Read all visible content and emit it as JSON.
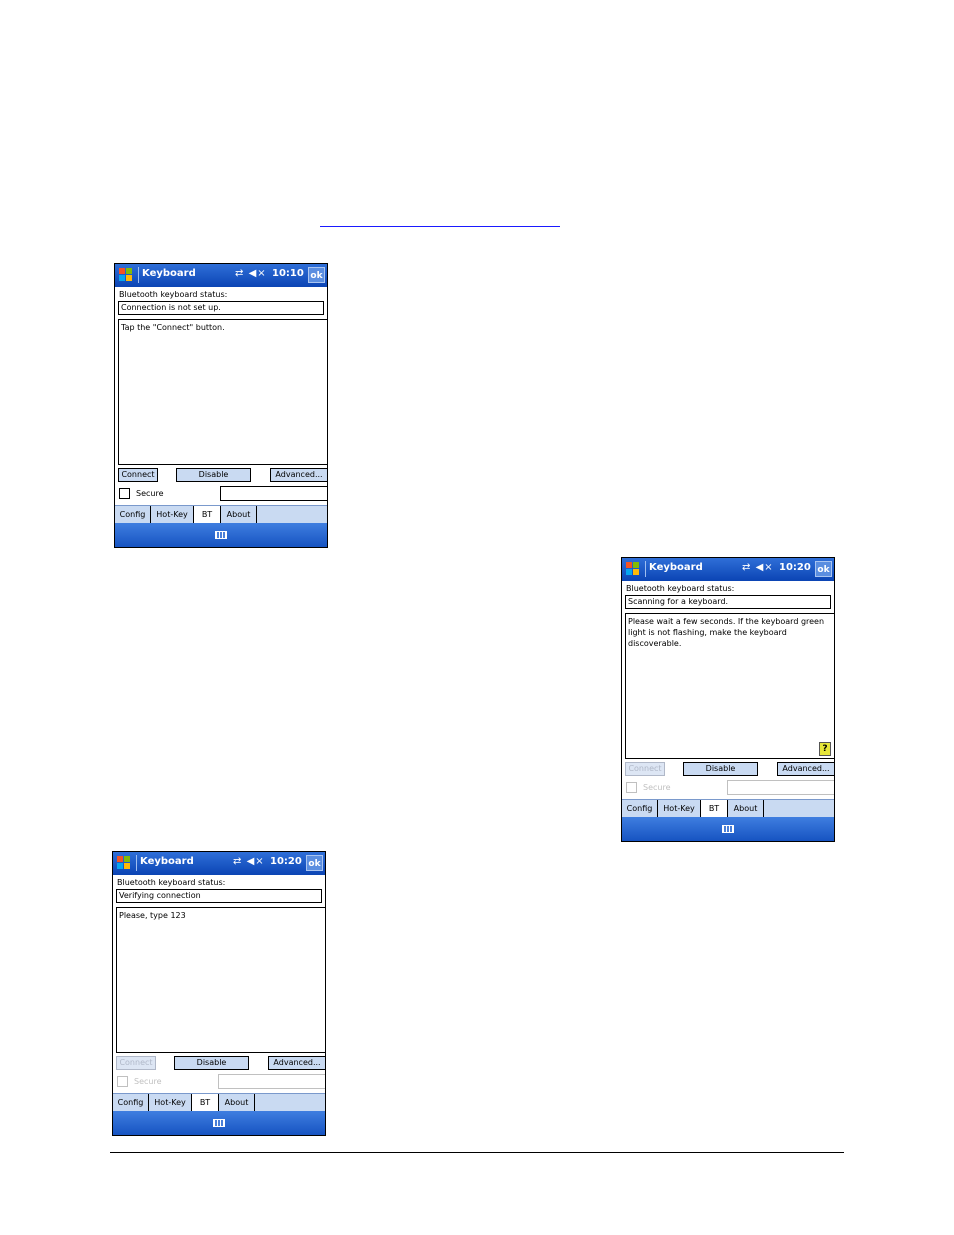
{
  "screens": [
    {
      "app_title": "Keyboard",
      "time": "10:10",
      "ok_label": "ok",
      "status_label": "Bluetooth keyboard status:",
      "status_value": "Connection is not set up.",
      "message": "Tap the \"Connect\" button.",
      "connect_label": "Connect",
      "disable_label": "Disable",
      "advanced_label": "Advanced...",
      "secure_label": "Secure",
      "tabs": [
        "Config",
        "Hot-Key",
        "BT",
        "About"
      ]
    },
    {
      "app_title": "Keyboard",
      "time": "10:20",
      "ok_label": "ok",
      "status_label": "Bluetooth keyboard status:",
      "status_value": "Scanning for a keyboard.",
      "message": "Please wait a few seconds. If the keyboard green light is not flashing, make the keyboard discoverable.",
      "connect_label": "Connect",
      "disable_label": "Disable",
      "advanced_label": "Advanced...",
      "secure_label": "Secure",
      "tabs": [
        "Config",
        "Hot-Key",
        "BT",
        "About"
      ],
      "help_glyph": "?"
    },
    {
      "app_title": "Keyboard",
      "time": "10:20",
      "ok_label": "ok",
      "status_label": "Bluetooth keyboard status:",
      "status_value": "Verifying connection",
      "message": "Please, type 123",
      "connect_label": "Connect",
      "disable_label": "Disable",
      "advanced_label": "Advanced...",
      "secure_label": "Secure",
      "tabs": [
        "Config",
        "Hot-Key",
        "BT",
        "About"
      ]
    }
  ],
  "icons": {
    "start": "windows-flag-icon",
    "connectivity": "connectivity-icon",
    "volume": "speaker-muted-icon",
    "keyboard": "keyboard-icon",
    "help": "help-icon"
  },
  "colors": {
    "titlebar": "#0b44b4",
    "tabbar": "#c9daf2",
    "link": "#1a1aff"
  }
}
